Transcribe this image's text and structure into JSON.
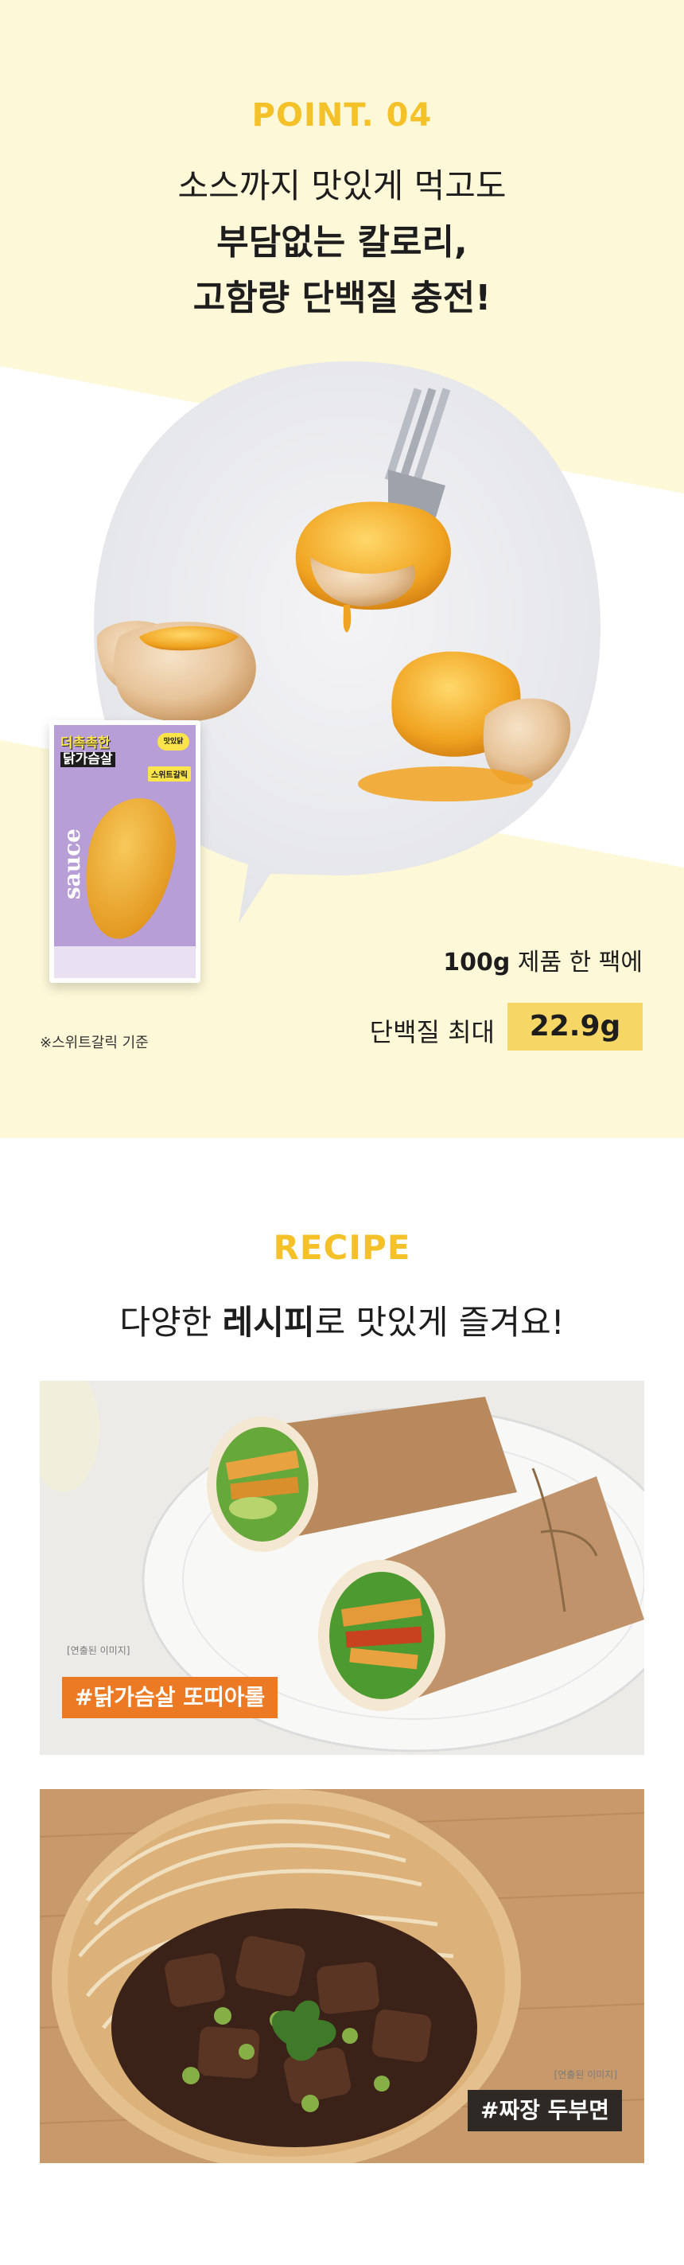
{
  "point": {
    "label": "POINT.",
    "number": "04",
    "headline_line1": "소스까지 맛있게 먹고도",
    "headline_line2": "부담없는 칼로리,",
    "headline_line3": "고함량 단백질 충전!"
  },
  "package": {
    "top_line1": "더촉촉한",
    "top_line2": "닭가슴살",
    "badge": "맛있닭",
    "flavor": "스위트갈릭",
    "sauce_word": "sauce"
  },
  "package_note": "※스위트갈릭 기준",
  "stats": {
    "line1_amount": "100g",
    "line1_rest": "제품 한 팩에",
    "line2_label": "단백질 최대",
    "line2_value": "22.9g"
  },
  "recipe": {
    "label": "RECIPE",
    "sub_pre": "다양한 ",
    "sub_bold": "레시피",
    "sub_post": "로 맛있게 즐겨요!"
  },
  "photos": [
    {
      "caption": "[연출된 이미지]",
      "tag": "#닭가슴살 또띠아롤"
    },
    {
      "caption": "[연출된 이미지]",
      "tag": "#짜장 두부면"
    }
  ],
  "colors": {
    "accent_yellow": "#f4c128",
    "background_cream": "#fdf8d8",
    "highlight": "#f6d765",
    "tag_orange": "#ec7a25",
    "tag_dark": "#2f2925"
  }
}
